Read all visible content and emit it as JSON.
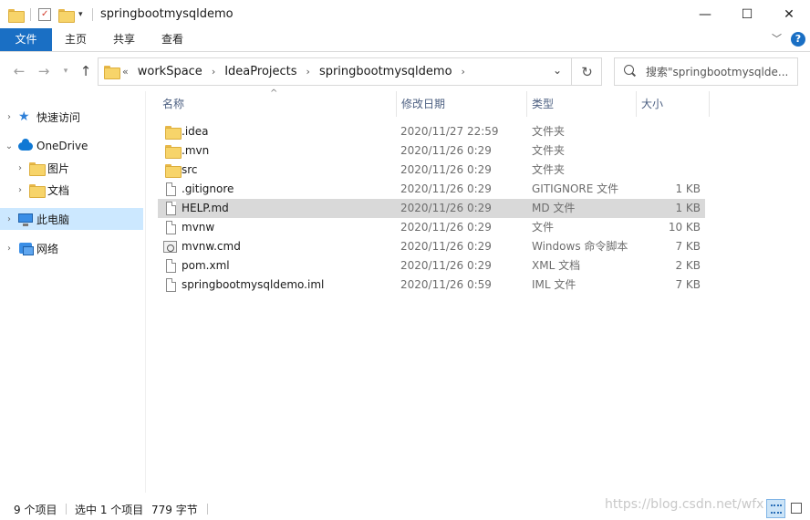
{
  "window": {
    "title": "springbootmysqldemo",
    "minimize": "—",
    "maximize": "☐",
    "close": "✕"
  },
  "ribbon": {
    "tabs": [
      "文件",
      "主页",
      "共享",
      "查看"
    ],
    "collapse_icon": "chevron-down-icon",
    "help": "?"
  },
  "address": {
    "overflow": "«",
    "crumbs": [
      "workSpace",
      "IdeaProjects",
      "springbootmysqldemo"
    ],
    "search_placeholder": "搜索\"springbootmysqlde..."
  },
  "nav": {
    "items": [
      {
        "label": "快速访问",
        "icon": "star-icon"
      },
      {
        "label": "OneDrive",
        "icon": "cloud-icon"
      },
      {
        "label": "图片",
        "icon": "folder-icon"
      },
      {
        "label": "文档",
        "icon": "folder-icon"
      },
      {
        "label": "此电脑",
        "icon": "computer-icon"
      },
      {
        "label": "网络",
        "icon": "network-icon"
      }
    ]
  },
  "columns": {
    "name": "名称",
    "date": "修改日期",
    "type": "类型",
    "size": "大小"
  },
  "files": [
    {
      "name": ".idea",
      "date": "2020/11/27 22:59",
      "type": "文件夹",
      "size": "",
      "icon": "folder-icon"
    },
    {
      "name": ".mvn",
      "date": "2020/11/26 0:29",
      "type": "文件夹",
      "size": "",
      "icon": "folder-icon"
    },
    {
      "name": "src",
      "date": "2020/11/26 0:29",
      "type": "文件夹",
      "size": "",
      "icon": "folder-icon"
    },
    {
      "name": ".gitignore",
      "date": "2020/11/26 0:29",
      "type": "GITIGNORE 文件",
      "size": "1 KB",
      "icon": "file-icon"
    },
    {
      "name": "HELP.md",
      "date": "2020/11/26 0:29",
      "type": "MD 文件",
      "size": "1 KB",
      "icon": "file-icon"
    },
    {
      "name": "mvnw",
      "date": "2020/11/26 0:29",
      "type": "文件",
      "size": "10 KB",
      "icon": "file-icon"
    },
    {
      "name": "mvnw.cmd",
      "date": "2020/11/26 0:29",
      "type": "Windows 命令脚本",
      "size": "7 KB",
      "icon": "script-icon"
    },
    {
      "name": "pom.xml",
      "date": "2020/11/26 0:29",
      "type": "XML 文档",
      "size": "2 KB",
      "icon": "file-icon"
    },
    {
      "name": "springbootmysqldemo.iml",
      "date": "2020/11/26 0:59",
      "type": "IML 文件",
      "size": "7 KB",
      "icon": "file-icon"
    }
  ],
  "status": {
    "count": "9 个项目",
    "selected": "选中 1 个项目",
    "bytes": "779 字节",
    "watermark": "https://blog.csdn.net/wfx"
  }
}
